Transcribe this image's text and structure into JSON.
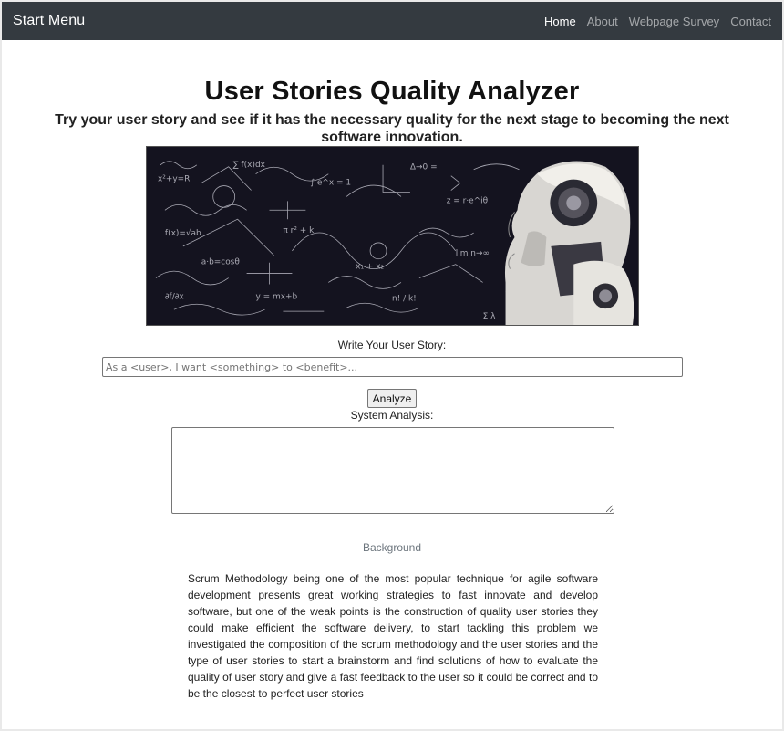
{
  "navbar": {
    "brand": "Start Menu",
    "links": [
      "Home",
      "About",
      "Webpage Survey",
      "Contact"
    ]
  },
  "main": {
    "title": "User Stories Quality Analyzer",
    "subtitle": "Try your user story and see if it has the necessary quality for the next stage to becoming the next software innovation.",
    "hero_image": "robot-math-chalkboard-image",
    "story_label": "Write Your User Story:",
    "story_placeholder": "As a <user>, I want <something> to <benefit>...",
    "story_value": "",
    "analyze_label": "Analyze",
    "system_label": "System Analysis:",
    "system_value": ""
  },
  "background": {
    "heading": "Background",
    "text": "Scrum Methodology being one of the most popular technique for agile software development presents great working strategies to fast innovate and develop software, but one of the weak points is the construction of quality user stories they could make efficient the software delivery, to start tackling this problem we investigated the composition of the scrum methodology and the user stories and the type of user stories to start a brainstorm and find solutions of how to evaluate the quality of user story and give a fast feedback to the user so it could be correct and to be the closest to perfect user stories"
  },
  "colors": {
    "navbar_bg": "#343a40",
    "page_bg": "#ffffff",
    "muted_text": "#6c757d"
  }
}
